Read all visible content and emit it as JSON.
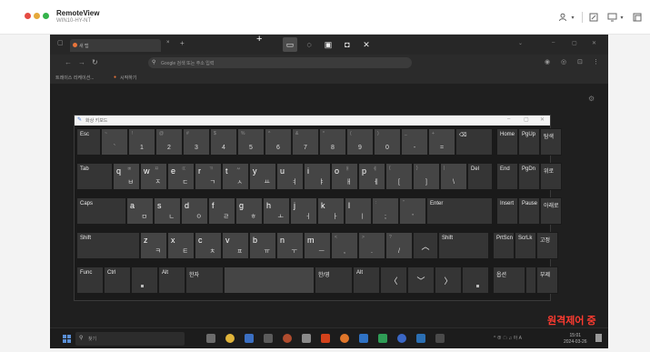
{
  "window": {
    "app_title": "RemoteView",
    "app_subtitle": "WIN10-HY-NT",
    "toolbar_icons": [
      "user-icon",
      "chevron-down-icon",
      "resize-icon",
      "monitor-icon",
      "chevron-down-icon",
      "tile-icon"
    ]
  },
  "remote_toolbar": {
    "tools": [
      {
        "name": "select-tool-icon",
        "glyph": "▭",
        "active": true
      },
      {
        "name": "lasso-tool-icon",
        "glyph": "◌",
        "active": false
      },
      {
        "name": "window-tool-icon",
        "glyph": "▣",
        "active": false
      },
      {
        "name": "fullscreen-tool-icon",
        "glyph": "◘",
        "active": false
      },
      {
        "name": "close-tool-icon",
        "glyph": "✕",
        "active": false
      }
    ]
  },
  "browser": {
    "tab_label": "새 탭",
    "tab_close": "×",
    "new_tab": "+",
    "address_placeholder": "Google 검색 또는 주소 입력",
    "bookmarks": [
      "트레이스 리케이션...",
      "시작하기"
    ],
    "win_min": "–",
    "win_max": "▢",
    "win_close": "✕"
  },
  "osk": {
    "title": "화상 키보드",
    "rows": [
      [
        {
          "top": "Esc",
          "dark": true,
          "w": 27
        },
        {
          "top": "~",
          "label": "`",
          "w": 30
        },
        {
          "top": "!",
          "label": "1",
          "w": 30
        },
        {
          "top": "@",
          "label": "2",
          "w": 30
        },
        {
          "top": "#",
          "label": "3",
          "w": 30
        },
        {
          "top": "$",
          "label": "4",
          "w": 30
        },
        {
          "top": "%",
          "label": "5",
          "w": 30
        },
        {
          "top": "^",
          "label": "6",
          "w": 30
        },
        {
          "top": "&",
          "label": "7",
          "w": 30
        },
        {
          "top": "*",
          "label": "8",
          "w": 30
        },
        {
          "top": "(",
          "label": "9",
          "w": 30
        },
        {
          "top": ")",
          "label": "0",
          "w": 30
        },
        {
          "top": "_",
          "label": "-",
          "w": 30
        },
        {
          "top": "+",
          "label": "=",
          "w": 30
        },
        {
          "top": "⌫",
          "dark": true,
          "w": 41
        },
        {
          "gap": 4
        },
        {
          "top": "Home",
          "dark": true,
          "w": 24
        },
        {
          "top": "PgUp",
          "dark": true,
          "w": 24
        },
        {
          "top": "탐색",
          "dark": true,
          "w": 24
        }
      ],
      [
        {
          "top": "Tab",
          "dark": true,
          "w": 40
        },
        {
          "main": "q",
          "shift": "ㅃ",
          "kor": "ㅂ",
          "w": 30
        },
        {
          "main": "w",
          "shift": "ㅉ",
          "kor": "ㅈ",
          "w": 30
        },
        {
          "main": "e",
          "shift": "ㄸ",
          "kor": "ㄷ",
          "w": 30
        },
        {
          "main": "r",
          "shift": "ㄲ",
          "kor": "ㄱ",
          "w": 30
        },
        {
          "main": "t",
          "shift": "ㅆ",
          "kor": "ㅅ",
          "w": 30
        },
        {
          "main": "y",
          "kor": "ㅛ",
          "w": 30
        },
        {
          "main": "u",
          "kor": "ㅕ",
          "w": 30
        },
        {
          "main": "i",
          "kor": "ㅑ",
          "w": 30
        },
        {
          "main": "o",
          "shift": "ㅒ",
          "kor": "ㅐ",
          "w": 30
        },
        {
          "main": "p",
          "shift": "ㅖ",
          "kor": "ㅔ",
          "w": 30
        },
        {
          "top": "{",
          "label": "[",
          "w": 30
        },
        {
          "top": "}",
          "label": "]",
          "w": 30
        },
        {
          "top": "|",
          "label": "\\",
          "w": 30
        },
        {
          "top": "Del",
          "dark": true,
          "w": 28
        },
        {
          "gap": 4
        },
        {
          "top": "End",
          "dark": true,
          "w": 24
        },
        {
          "top": "PgDn",
          "dark": true,
          "w": 24
        },
        {
          "top": "위로",
          "dark": true,
          "w": 24
        }
      ],
      [
        {
          "top": "Caps",
          "dark": true,
          "w": 55
        },
        {
          "main": "a",
          "kor": "ㅁ",
          "w": 30
        },
        {
          "main": "s",
          "kor": "ㄴ",
          "w": 30
        },
        {
          "main": "d",
          "kor": "ㅇ",
          "w": 30
        },
        {
          "main": "f",
          "kor": "ㄹ",
          "w": 30
        },
        {
          "main": "g",
          "kor": "ㅎ",
          "w": 30
        },
        {
          "main": "h",
          "kor": "ㅗ",
          "w": 30
        },
        {
          "main": "j",
          "kor": "ㅓ",
          "w": 30
        },
        {
          "main": "k",
          "kor": "ㅏ",
          "w": 30
        },
        {
          "main": "l",
          "kor": "ㅣ",
          "w": 30
        },
        {
          "top": ":",
          "label": ";",
          "w": 30
        },
        {
          "top": "\"",
          "label": "'",
          "w": 30
        },
        {
          "top": "Enter",
          "dark": true,
          "w": 73
        },
        {
          "gap": 4
        },
        {
          "top": "Insert",
          "dark": true,
          "w": 24
        },
        {
          "top": "Pause",
          "dark": true,
          "w": 24
        },
        {
          "top": "아래로",
          "dark": true,
          "w": 24
        }
      ],
      [
        {
          "top": "Shift",
          "dark": true,
          "w": 70
        },
        {
          "main": "z",
          "kor": "ㅋ",
          "w": 30
        },
        {
          "main": "x",
          "kor": "ㅌ",
          "w": 30
        },
        {
          "main": "c",
          "kor": "ㅊ",
          "w": 30
        },
        {
          "main": "v",
          "kor": "ㅍ",
          "w": 30
        },
        {
          "main": "b",
          "kor": "ㅠ",
          "w": 30
        },
        {
          "main": "n",
          "kor": "ㅜ",
          "w": 30
        },
        {
          "main": "m",
          "kor": "ㅡ",
          "w": 30
        },
        {
          "top": "<",
          "label": ",",
          "w": 30
        },
        {
          "top": ">",
          "label": ".",
          "w": 30
        },
        {
          "top": "?",
          "label": "/",
          "w": 30
        },
        {
          "center": "︿",
          "dark": true,
          "w": 28
        },
        {
          "top": "Shift",
          "dark": true,
          "w": 56
        },
        {
          "gap": 4
        },
        {
          "top": "PrtScn",
          "dark": true,
          "w": 24
        },
        {
          "top": "ScrLk",
          "dark": true,
          "w": 24
        },
        {
          "top": "고정",
          "dark": true,
          "w": 24
        }
      ],
      [
        {
          "top": "Func",
          "dark": true,
          "w": 30
        },
        {
          "top": "Ctrl",
          "dark": true,
          "w": 30
        },
        {
          "dotleft": true,
          "dark": true,
          "w": 30
        },
        {
          "top": "Alt",
          "dark": true,
          "w": 30
        },
        {
          "top": "한자",
          "dark": true,
          "w": 42
        },
        {
          "blank": true,
          "w": 100
        },
        {
          "top": "한/영",
          "dark": true,
          "w": 42
        },
        {
          "top": "Alt",
          "dark": true,
          "w": 30
        },
        {
          "center": "〈",
          "dark": true,
          "w": 30
        },
        {
          "center": "﹀",
          "dark": true,
          "w": 30
        },
        {
          "center": "〉",
          "dark": true,
          "w": 30
        },
        {
          "dotright": true,
          "dark": true,
          "w": 30
        },
        {
          "gap": 4
        },
        {
          "top": "옵션",
          "dark": true,
          "w": 36
        },
        {
          "top": "",
          "dark": true,
          "w": 12
        },
        {
          "top": "부제",
          "dark": true,
          "w": 24
        }
      ]
    ]
  },
  "taskbar": {
    "search_placeholder": "찾기",
    "apps": [
      {
        "name": "task-view-icon",
        "color": "#6c6c6c"
      },
      {
        "name": "chrome-icon",
        "color": "#e0b43a"
      },
      {
        "name": "file-explorer-icon",
        "color": "#3b6fc2"
      },
      {
        "name": "mail-icon",
        "color": "#5b5b5b"
      },
      {
        "name": "app-v-icon",
        "color": "#b04c2e"
      },
      {
        "name": "obs-icon",
        "color": "#8a8a8a"
      },
      {
        "name": "app-o-icon",
        "color": "#d3421b"
      },
      {
        "name": "remoteview-icon",
        "color": "#e0762a"
      },
      {
        "name": "store-icon",
        "color": "#2f72c4"
      },
      {
        "name": "chrome-2-icon",
        "color": "#2f9d56"
      },
      {
        "name": "app-blue-icon",
        "color": "#3a67c6"
      },
      {
        "name": "app-globe-icon",
        "color": "#2b6fb3"
      },
      {
        "name": "app-dark-icon",
        "color": "#4a4a4a"
      }
    ],
    "clock_time": "15:01",
    "clock_date": "2024-03-26",
    "tray_text": "^ ⊕ ☁ ♫ 아 A"
  },
  "remote_status": "원격제어 중"
}
